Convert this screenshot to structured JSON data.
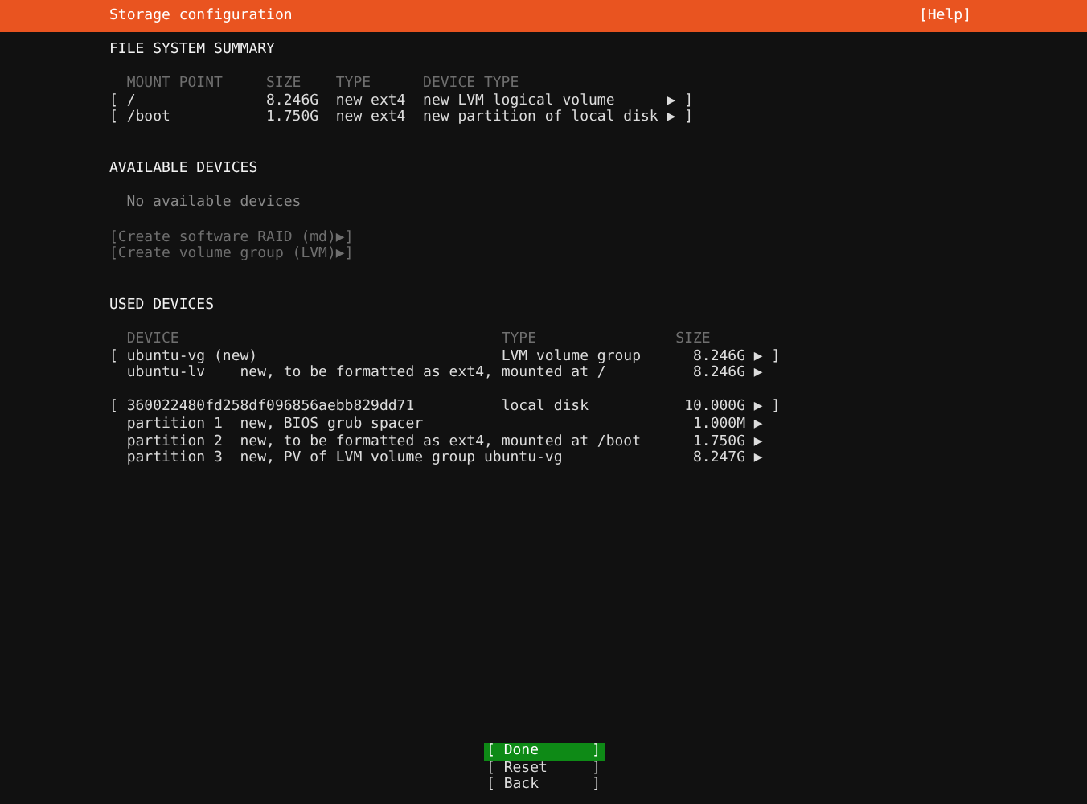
{
  "header": {
    "title": "Storage configuration",
    "help": {
      "open": "[",
      "label": "Help",
      "close": "]"
    }
  },
  "file_system_summary": {
    "title": "FILE SYSTEM SUMMARY",
    "columns": [
      "MOUNT POINT",
      "SIZE",
      "TYPE",
      "DEVICE TYPE"
    ],
    "rows": [
      {
        "open": "[",
        "mount_point": "/",
        "size": "8.246G",
        "type": "new ext4",
        "device_type": "new LVM logical volume",
        "arrow": "▶",
        "close": "]"
      },
      {
        "open": "[",
        "mount_point": "/boot",
        "size": "1.750G",
        "type": "new ext4",
        "device_type": "new partition of local disk",
        "arrow": "▶",
        "close": "]"
      }
    ]
  },
  "available_devices": {
    "title": "AVAILABLE DEVICES",
    "empty_message": "No available devices",
    "actions": [
      {
        "open": "[",
        "label": "Create software RAID (md)",
        "arrow": "▶",
        "close": "]",
        "disabled": true
      },
      {
        "open": "[",
        "label": "Create volume group (LVM)",
        "arrow": "▶",
        "close": "]",
        "disabled": true
      }
    ]
  },
  "used_devices": {
    "title": "USED DEVICES",
    "columns": [
      "DEVICE",
      "TYPE",
      "SIZE"
    ],
    "devices": [
      {
        "open": "[",
        "name": "ubuntu-vg (new)",
        "type": "LVM volume group",
        "size": "8.246G",
        "arrow": "▶",
        "close": "]",
        "children": [
          {
            "name": "ubuntu-lv",
            "description": "new, to be formatted as ext4, mounted at /",
            "size": "8.246G",
            "arrow": "▶"
          }
        ]
      },
      {
        "open": "[",
        "name": "360022480fd258df096856aebb829dd71",
        "type": "local disk",
        "size": "10.000G",
        "arrow": "▶",
        "close": "]",
        "children": [
          {
            "name": "partition 1",
            "description": "new, BIOS grub spacer",
            "size": "1.000M",
            "arrow": "▶"
          },
          {
            "name": "partition 2",
            "description": "new, to be formatted as ext4, mounted at /boot",
            "size": "1.750G",
            "arrow": "▶"
          },
          {
            "name": "partition 3",
            "description": "new, PV of LVM volume group ubuntu-vg",
            "size": "8.247G",
            "arrow": "▶"
          }
        ]
      }
    ]
  },
  "buttons": [
    {
      "open": "[",
      "label": "Done",
      "close": "]",
      "selected": true
    },
    {
      "open": "[",
      "label": "Reset",
      "close": "]",
      "selected": false
    },
    {
      "open": "[",
      "label": "Back",
      "close": "]",
      "selected": false
    }
  ]
}
